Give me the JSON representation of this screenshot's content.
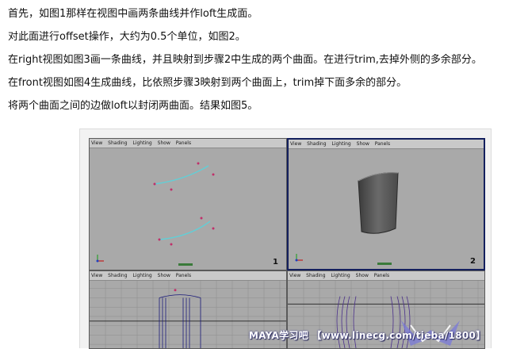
{
  "instructions": [
    "首先，如图1那样在视图中画两条曲线并作loft生成面。",
    "对此面进行offset操作，大约为0.5个单位，如图2。",
    "在right视图如图3画一条曲线，并且映射到步骤2中生成的两个曲面。在进行trim,去掉外侧的多余部分。",
    "在front视图如图4生成曲线，比依照步骤3映射到两个曲面上，trim掉下面多余的部分。",
    "将两个曲面之间的边做loft以封闭两曲面。结果如图5。"
  ],
  "viewport_menu": [
    "View",
    "Shading",
    "Lighting",
    "Show",
    "Panels"
  ],
  "panels": [
    {
      "number": "1"
    },
    {
      "number": "2"
    },
    {
      "number": ""
    },
    {
      "number": ""
    }
  ],
  "watermark": "MAYA学习吧 【www.linecg.com/tieba/1800】",
  "colors": {
    "viewport_bg": "#a9a9a9",
    "active_border": "#14205e",
    "curve": "#5fd0d8",
    "cv_point": "#c0306a",
    "surface": "#5e5e5e",
    "wire": "#4a2f8a"
  }
}
